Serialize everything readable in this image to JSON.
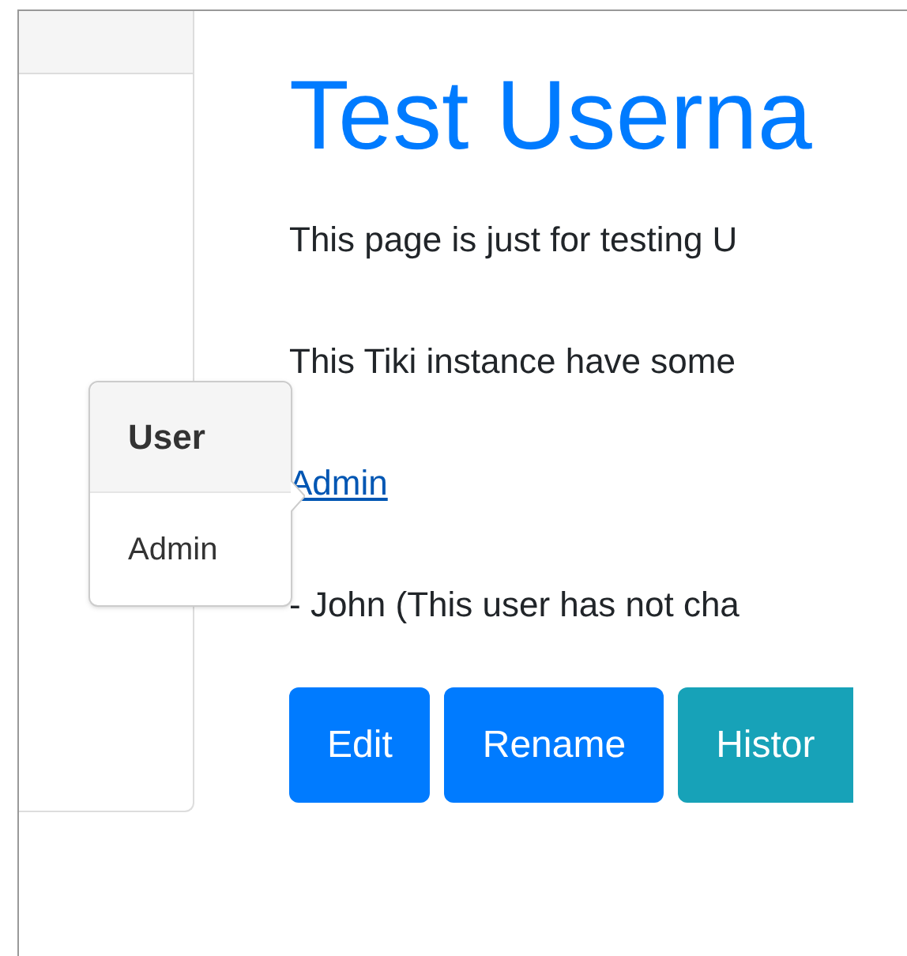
{
  "title": "Test Userna",
  "paragraphs": [
    {
      "kind": "text",
      "text": "This page is just for testing U"
    },
    {
      "kind": "text",
      "text": "This Tiki instance have some"
    },
    {
      "kind": "link",
      "text": "Admin"
    },
    {
      "kind": "text",
      "text": "- John (This user has not cha"
    }
  ],
  "popover": {
    "header": "User",
    "body": "Admin"
  },
  "buttons": [
    {
      "label": "Edit",
      "kind": "primary"
    },
    {
      "label": "Rename",
      "kind": "primary"
    },
    {
      "label": "Histor",
      "kind": "info"
    }
  ]
}
